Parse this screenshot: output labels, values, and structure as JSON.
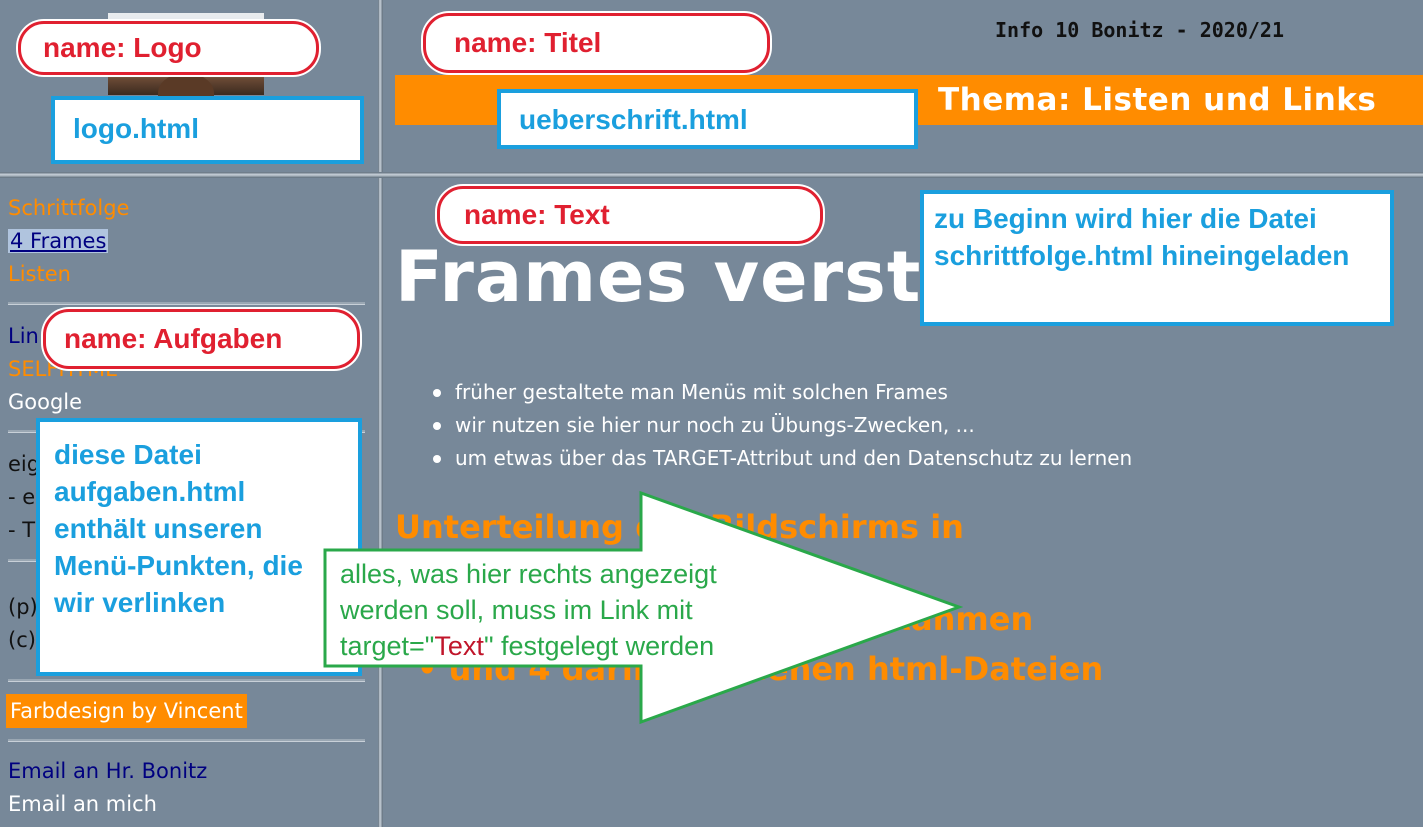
{
  "logo_frame": {
    "photo": "Portrait photo"
  },
  "titel_frame": {
    "info": "Info 10 Bonitz - 2020/21",
    "thema": "Thema: Listen und Links"
  },
  "aufgaben_frame": {
    "menu": {
      "schrittfolge": "Schrittfolge",
      "frames": "4 Frames",
      "listen": "Listen",
      "links_partial": "Lin",
      "selfhtml_partial": "SELFHTML",
      "google": "Google",
      "eig_partial": "eig",
      "dash_e": "- e",
      "dash_t": "- T",
      "p_partial": "(p)",
      "c_partial": "(c)",
      "farbdesign": "Farbdesign by Vincent",
      "email_bonitz": "Email an Hr. Bonitz",
      "email_mich": "Email an mich"
    }
  },
  "text_frame": {
    "title": "Frames verstehen",
    "bullets": [
      "früher gestaltete man Menüs mit solchen Frames",
      "wir nutzen sie hier nur noch zu Übungs-Zwecken, ...",
      "um etwas über das TARGET-Attribut und den Datenschutz zu lernen"
    ],
    "subheading": "Unterteilung des Bildschirms in",
    "sub_item_frames": "4 Rahmen",
    "sub_item_dateien": "• und 4 darin geladenen html-Dateien"
  },
  "annotations": {
    "logo_name": "name: Logo",
    "logo_file": "logo.html",
    "titel_name": "name: Titel",
    "titel_file": "ueberschrift.html",
    "text_name": "name: Text",
    "text_note": "zu Beginn wird hier die Datei schrittfolge.html hineingeladen",
    "aufgaben_name": "name: Aufgaben",
    "aufgaben_note": "diese Datei aufgaben.html enthält unseren Menü-Punkten, die wir verlinken",
    "arrow_pre": "alles, was hier rechts angezeigt werden soll, muss im Link mit target=\"",
    "arrow_red": "Text",
    "arrow_post": "\" festgelegt werden"
  },
  "colors": {
    "frame_bg": "#778899",
    "accent_orange": "#ff8c00",
    "callout_red": "#e02030",
    "callout_blue": "#1a9fde",
    "arrow_green": "#2aa84a"
  }
}
